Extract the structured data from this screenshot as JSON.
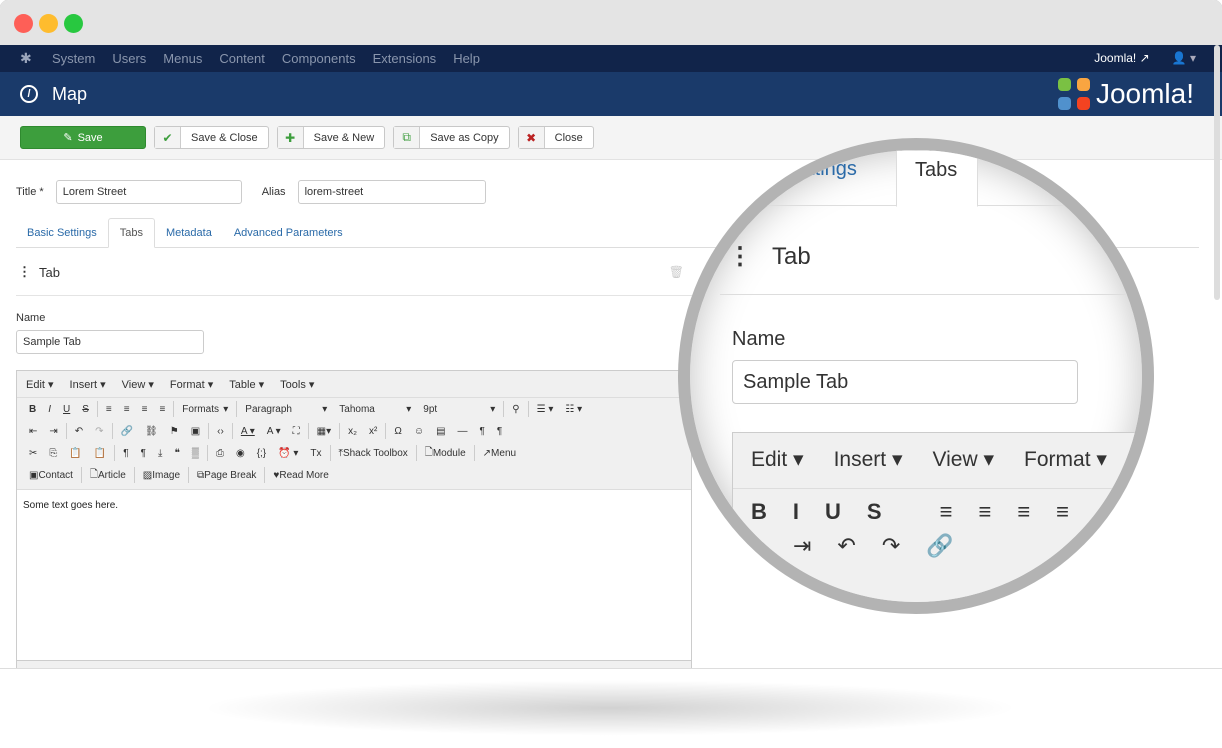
{
  "window": {
    "colors": {
      "close": "#fe5f57",
      "min": "#febc2e",
      "max": "#28c840"
    }
  },
  "nav": {
    "items": [
      "System",
      "Users",
      "Menus",
      "Content",
      "Components",
      "Extensions",
      "Help"
    ],
    "site_link": "Joomla!",
    "site_icon": "external-link-icon",
    "user_icon": "user-icon"
  },
  "header": {
    "title": "Map",
    "icon": "compass-icon",
    "brand": "Joomla!"
  },
  "toolbar": {
    "buttons": [
      {
        "label": "Save",
        "icon": "edit-icon"
      },
      {
        "label": "Save & Close",
        "icon": "check-icon"
      },
      {
        "label": "Save & New",
        "icon": "plus-icon"
      },
      {
        "label": "Save as Copy",
        "icon": "copy-icon"
      },
      {
        "label": "Close",
        "icon": "cancel-icon"
      }
    ]
  },
  "form": {
    "title_label": "Title *",
    "title_value": "Lorem Street",
    "alias_label": "Alias",
    "alias_value": "lorem-street",
    "tabs": [
      "Basic Settings",
      "Tabs",
      "Metadata",
      "Advanced Parameters"
    ],
    "active_tab": "Tabs",
    "section_title": "Tab",
    "name_label": "Name",
    "name_value": "Sample Tab"
  },
  "editor": {
    "menus": [
      "Edit",
      "Insert",
      "View",
      "Format",
      "Table",
      "Tools"
    ],
    "formats": "Formats",
    "block": "Paragraph",
    "font": "Tahoma",
    "size": "9pt",
    "buttons": [
      "Shack Toolbox",
      "Module",
      "Menu",
      "Contact",
      "Article",
      "Image",
      "Page Break",
      "Read More"
    ],
    "content": "Some text goes here."
  },
  "magnifier": {
    "tab_partial": "ettings",
    "tab_active": "Tabs",
    "section": "Tab",
    "name_label": "Name",
    "name_value": "Sample Tab",
    "menus": [
      "Edit",
      "Insert",
      "View",
      "Format"
    ]
  }
}
